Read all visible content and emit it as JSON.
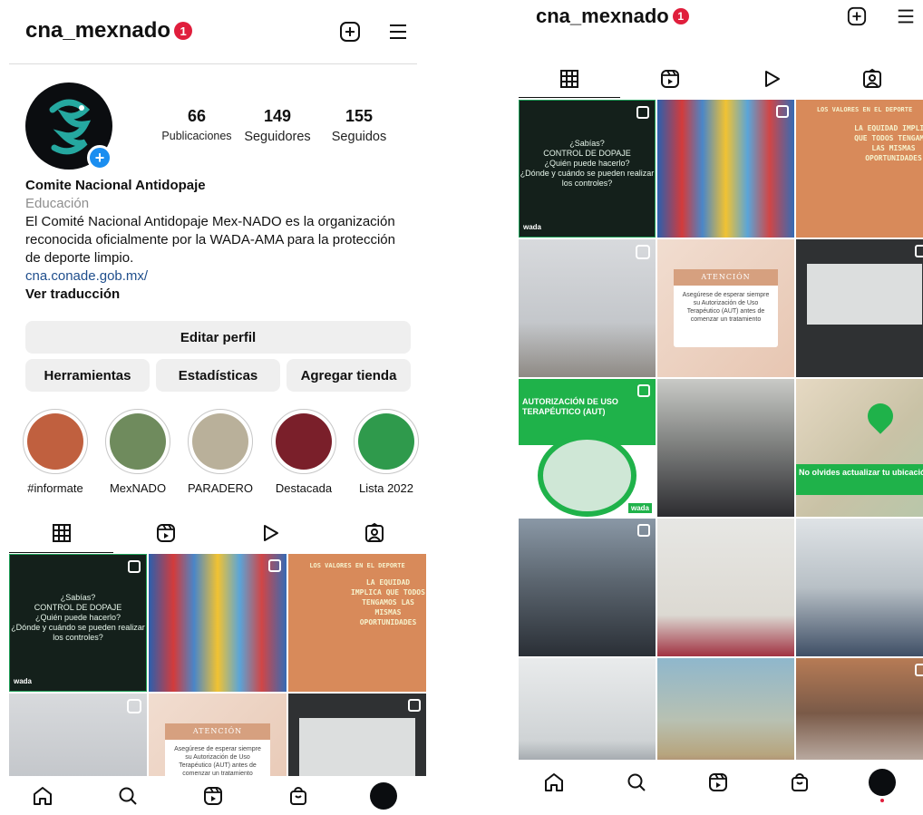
{
  "profile": {
    "username": "cna_mexnado",
    "notification_count": "1",
    "stats": {
      "posts": {
        "value": "66",
        "label": "Publicaciones"
      },
      "followers": {
        "value": "149",
        "label": "Seguidores"
      },
      "following": {
        "value": "155",
        "label": "Seguidos"
      }
    },
    "name": "Comite Nacional Antidopaje",
    "category": "Educación",
    "bio": "El Comité Nacional Antidopaje Mex-NADO es la organización reconocida oficialmente por la WADA-AMA para la protección de deporte limpio.",
    "link": "cna.conade.gob.mx/",
    "see_translation": "Ver traducción",
    "edit_profile": "Editar perfil",
    "tools": "Herramientas",
    "insights": "Estadísticas",
    "add_shop": "Agregar tienda"
  },
  "highlights": [
    {
      "label": "#informate",
      "color": "#c0603f"
    },
    {
      "label": "MexNADO",
      "color": "#6f8b5d"
    },
    {
      "label": "PARADERO",
      "color": "#b9b09a"
    },
    {
      "label": "Destacada",
      "color": "#7a1f2a"
    },
    {
      "label": "Lista 2022",
      "color": "#2f9a4c"
    }
  ],
  "posts": {
    "dopaje": {
      "text": "¿Sabías?\nCONTROL DE DOPAJE\n¿Quién puede hacerlo?\n¿Dónde y cuándo se pueden realizar los controles?",
      "brand": "wada"
    },
    "valores": {
      "title": "LOS VALORES EN EL DEPORTE",
      "text": "LA EQUIDAD IMPLICA QUE TODOS TENGAMOS LAS MISMAS OPORTUNIDADES"
    },
    "atencion": {
      "title": "ATENCIÓN",
      "text": "Asegúrese de esperar siempre su Autorización de Uso Terapéutico (AUT) antes de comenzar un tratamiento"
    },
    "aut": {
      "title": "AUTORIZACIÓN DE USO TERAPÉUTICO (AUT)",
      "brand": "wada"
    },
    "ubicacion": {
      "text": "No olvides actualizar tu ubicación"
    }
  },
  "icons": {
    "new_post": "plus-square-icon",
    "menu": "hamburger-menu-icon",
    "grid_tab": "grid-icon",
    "reels_tab": "reels-icon",
    "video_tab": "play-icon",
    "tagged_tab": "tagged-person-icon",
    "home": "home-icon",
    "search": "search-icon",
    "reels": "reels-icon",
    "shop": "shopping-bag-icon"
  }
}
